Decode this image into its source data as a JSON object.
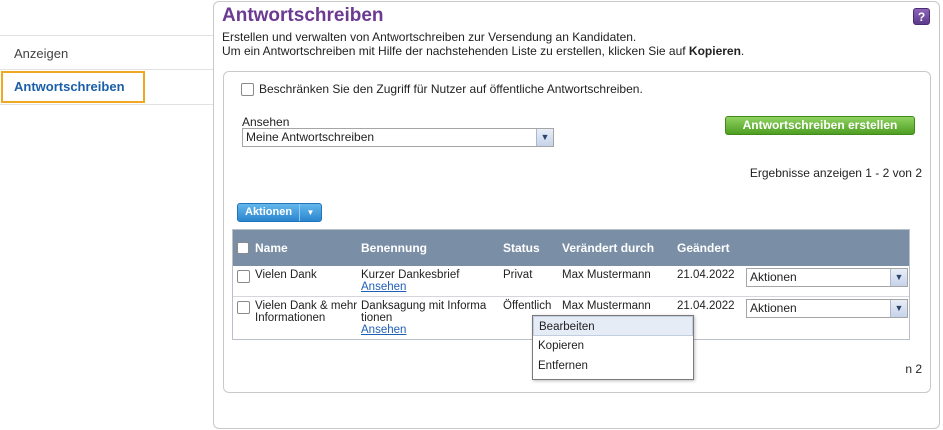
{
  "sidebar": {
    "items": [
      {
        "label": "Anzeigen"
      },
      {
        "label": "Antwortschreiben"
      }
    ]
  },
  "page": {
    "title": "Antwortschreiben",
    "help_label": "?",
    "desc_line1": "Erstellen und verwalten von Antwortschreiben zur Versendung an Kandidaten.",
    "desc_line2_prefix": "Um ein Antwortschreiben mit Hilfe der nachstehenden Liste zu erstellen, klicken Sie auf ",
    "desc_line2_bold": "Kopieren",
    "desc_line2_suffix": "."
  },
  "filters": {
    "restrict_label": "Beschränken Sie den Zugriff für Nutzer auf öffentliche Antwortschreiben.",
    "view_label": "Ansehen",
    "view_value": "Meine Antwortschreiben",
    "create_button": "Antwortschreiben erstellen"
  },
  "results_text": "Ergebnisse anzeigen 1 - 2 von 2",
  "results_bottom_visible": "n 2",
  "actions_button": "Aktionen",
  "table": {
    "headers": {
      "name": "Name",
      "benennung": "Benennung",
      "status": "Status",
      "veraendert": "Verändert durch",
      "geaendert": "Geändert"
    },
    "rows": [
      {
        "name": "Vielen Dank",
        "benennung": "Kurzer Dankesbrief",
        "link": "Ansehen",
        "status": "Privat",
        "veraendert": "Max Mustermann",
        "geaendert": "21.04.2022",
        "action": "Aktionen"
      },
      {
        "name_line1": "Vielen Dank & mehr",
        "name_line2": "Informationen",
        "benennung_line1": "Danksagung mit Informa",
        "benennung_line2": "tionen",
        "link": "Ansehen",
        "status": "Öffentlich",
        "veraendert": "Max Mustermann",
        "geaendert": "21.04.2022",
        "action": "Aktionen"
      }
    ]
  },
  "dropdown_options": [
    "Bearbeiten",
    "Kopieren",
    "Entfernen"
  ]
}
